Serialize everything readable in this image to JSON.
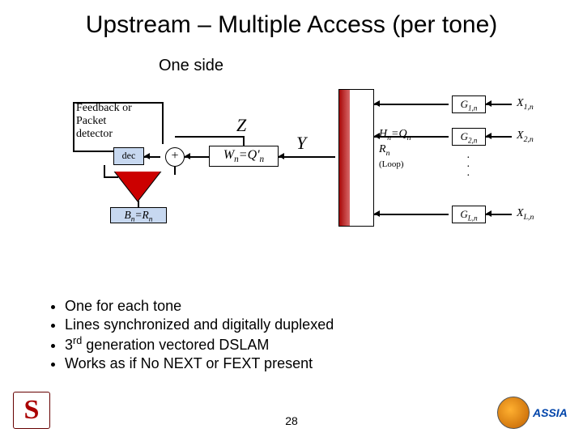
{
  "slide": {
    "title": "Upstream – Multiple Access (per tone)",
    "subtitle": "One side",
    "page_number": "28"
  },
  "diagram": {
    "feedback_label": "Feedback or\nPacket\ndetector",
    "dec_label": "dec",
    "plus_label": "+",
    "bn_label": "Bₙ=Rₙ",
    "wn_label": "Wₙ=Q'ₙ",
    "z_label": "Z",
    "y_label": "Y",
    "hn_label_line1": "Hₙ=Qₙ",
    "hn_label_line2": "Rₙ",
    "hn_sublabel": "(Loop)",
    "g_labels": [
      "G₁,ₙ",
      "G₂,ₙ",
      "G_L,ₙ"
    ],
    "x_labels": [
      "X₁,ₙ",
      "X₂,ₙ",
      "X_L,ₙ"
    ]
  },
  "bullets": [
    "One for each tone",
    "Lines synchronized and digitally duplexed",
    "3rd generation vectored DSLAM",
    "Works as if No NEXT or FEXT present"
  ],
  "logos": {
    "left_alt": "Stanford seal",
    "right_text": "ASSIA"
  }
}
